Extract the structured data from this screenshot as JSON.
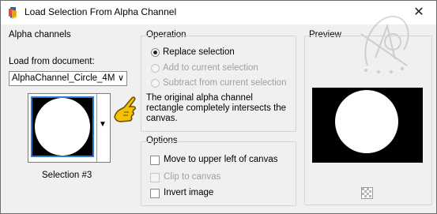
{
  "window": {
    "title": "Load Selection From Alpha Channel",
    "close_glyph": "✕"
  },
  "alpha_channels": {
    "heading": "Alpha channels",
    "load_from_label": "Load from document:",
    "document_value": "AlphaChannel_Circle_4M",
    "dropdown_arrow": "∨",
    "thumb_arrow": "▼",
    "selection_caption": "Selection #3"
  },
  "operation": {
    "heading": "Operation",
    "options": [
      {
        "label": "Replace selection",
        "selected": true,
        "enabled": true
      },
      {
        "label": "Add to current selection",
        "selected": false,
        "enabled": false
      },
      {
        "label": "Subtract from current selection",
        "selected": false,
        "enabled": false
      }
    ],
    "info_text": "The original alpha channel rectangle completely intersects the canvas."
  },
  "options": {
    "heading": "Options",
    "items": [
      {
        "label": "Move to upper left of canvas",
        "checked": false,
        "enabled": true
      },
      {
        "label": "Clip to canvas",
        "checked": false,
        "enabled": false
      },
      {
        "label": "Invert image",
        "checked": false,
        "enabled": true
      }
    ]
  },
  "preview": {
    "heading": "Preview"
  },
  "colors": {
    "accent": "#2b7ad4",
    "hand": "#f2c200",
    "preview_bg": "#000000"
  },
  "icons": {
    "app": "psp-app-icon",
    "hand": "pointing-hand-icon",
    "zoom": "preview-zoom-icon",
    "watermark": "watermark-logo"
  }
}
